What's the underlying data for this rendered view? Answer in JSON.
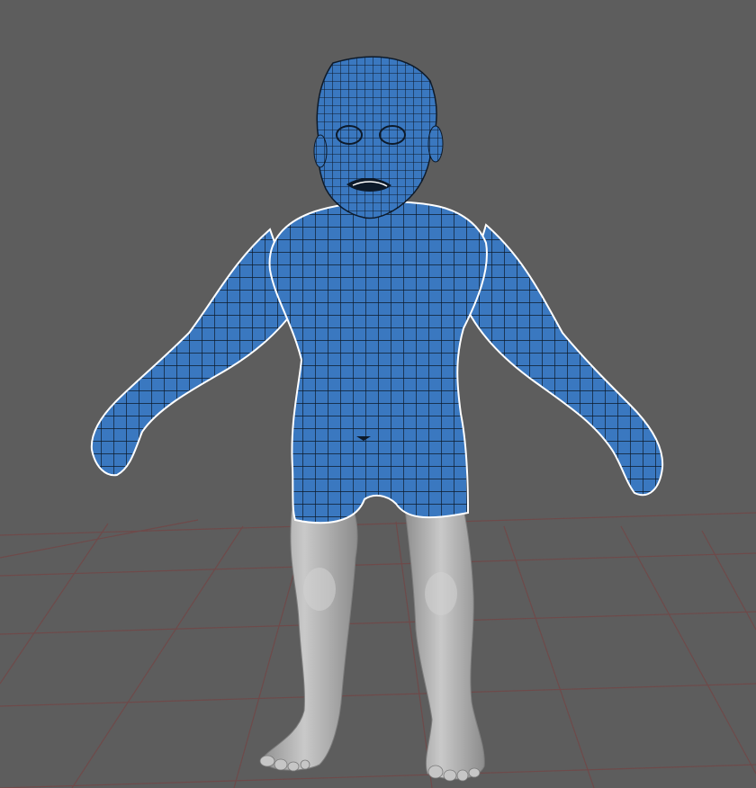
{
  "viewport": {
    "background": "#5d5d5d",
    "grid_line_color": "#6e4a4a",
    "retopo_mesh_color": "#3a78c0",
    "wire_color": "#0d1a2a",
    "sculpt_color": "#b8b8b8",
    "sculpt_shadow_color": "#8a8a8a"
  },
  "scene": {
    "icon": "character-mesh-icon",
    "pose": "A-pose"
  }
}
